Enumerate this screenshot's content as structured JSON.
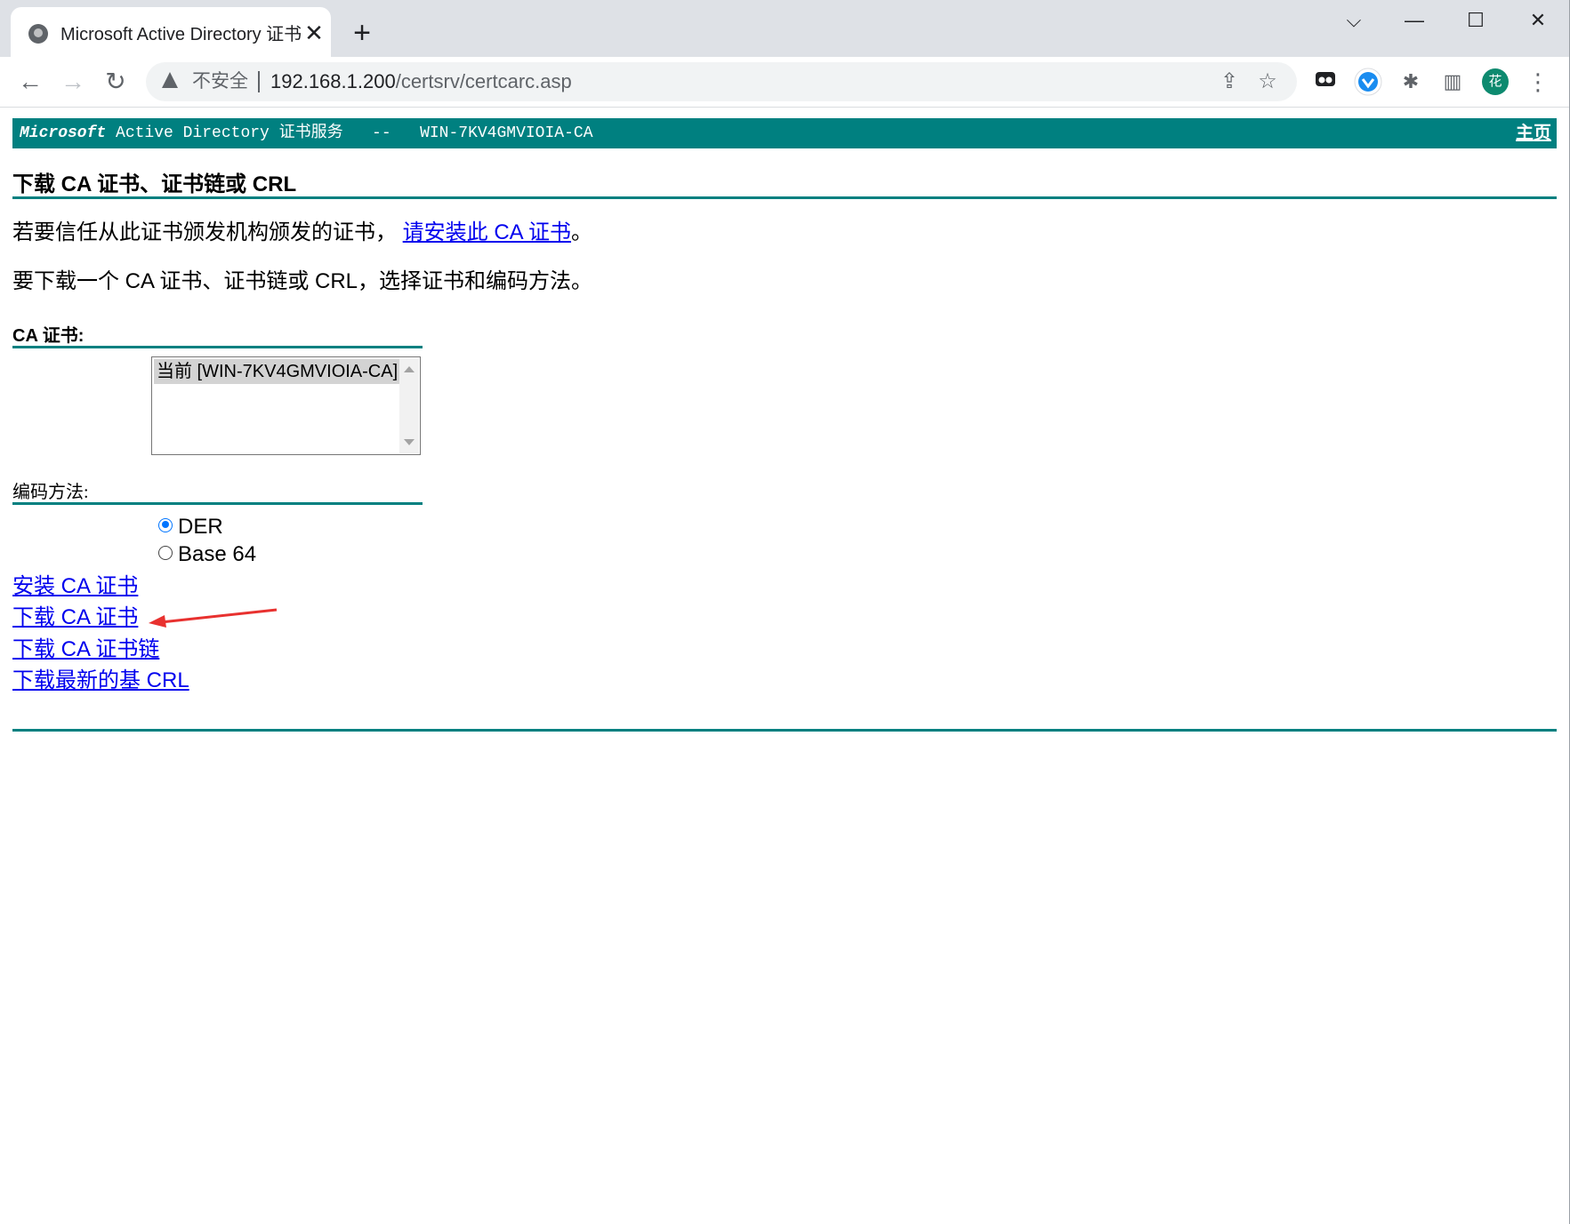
{
  "browser": {
    "tab_title": "Microsoft Active Directory 证书",
    "tab_close": "✕",
    "new_tab": "+",
    "window_controls": {
      "dropdown": "⌵",
      "minimize": "—",
      "maximize": "☐",
      "close": "✕"
    },
    "nav": {
      "back": "←",
      "forward": "→",
      "reload": "↻"
    },
    "not_secure_label": "不安全",
    "url_host": "192.168.1.200",
    "url_path": "/certsrv/certcarc.asp",
    "share_icon": "⇪",
    "bookmark_icon": "☆",
    "extensions_icon": "✱",
    "sidepanel_icon": "▥",
    "menu_icon": "⋮",
    "profile_avatar": "花"
  },
  "page": {
    "banner": {
      "brand": "Microsoft",
      "service": " Active Directory 证书服务   --   WIN-7KV4GMVIOIA-CA",
      "home_link": "主页"
    },
    "heading": "下载 CA 证书、证书链或 CRL",
    "trust_text": "若要信任从此证书颁发机构颁发的证书，",
    "install_chain_link": "请安装此 CA 证书",
    "trust_suffix": "。",
    "instruction": "要下载一个 CA 证书、证书链或 CRL，选择证书和编码方法。",
    "ca_cert_label": "CA 证书:",
    "ca_cert_options": [
      "当前 [WIN-7KV4GMVIOIA-CA]"
    ],
    "encoding_label": "编码方法:",
    "encoding_options": [
      {
        "label": "DER",
        "selected": true
      },
      {
        "label": "Base 64",
        "selected": false
      }
    ],
    "actions": {
      "install_ca": "安装 CA 证书",
      "download_ca": "下载 CA 证书",
      "download_chain": "下载 CA 证书链",
      "download_crl": "下载最新的基 CRL"
    }
  },
  "colors": {
    "banner": "#008080",
    "rule": "#008080",
    "link": "#0000ee",
    "annotation_arrow": "#e8312f",
    "avatar": "#0d8a6f"
  }
}
